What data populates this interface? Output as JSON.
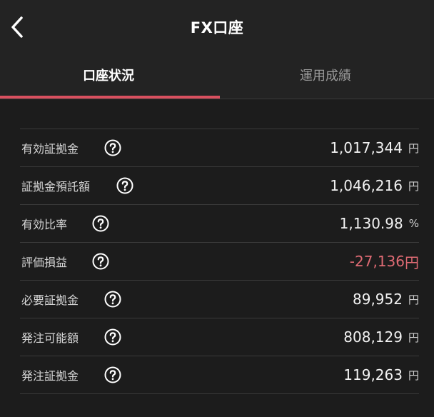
{
  "header": {
    "title": "FX口座"
  },
  "tabs": [
    {
      "label": "口座状況"
    },
    {
      "label": "運用成績"
    }
  ],
  "rows": [
    {
      "label": "有効証拠金",
      "value": "1,017,344",
      "unit": "円"
    },
    {
      "label": "証拠金預託額",
      "value": "1,046,216",
      "unit": "円"
    },
    {
      "label": "有効比率",
      "value": "1,130.98",
      "unit": "%"
    },
    {
      "label": "評価損益",
      "value": "-27,136",
      "unit": "円"
    },
    {
      "label": "必要証拠金",
      "value": "89,952",
      "unit": "円"
    },
    {
      "label": "発注可能額",
      "value": "808,129",
      "unit": "円"
    },
    {
      "label": "発注証拠金",
      "value": "119,263",
      "unit": "円"
    }
  ],
  "colors": {
    "accent": "#d9505f",
    "negative": "#e06b74",
    "background": "#1c1c1c"
  },
  "icons": {
    "back": "chevron-left-icon",
    "help": "question-circle-icon"
  }
}
